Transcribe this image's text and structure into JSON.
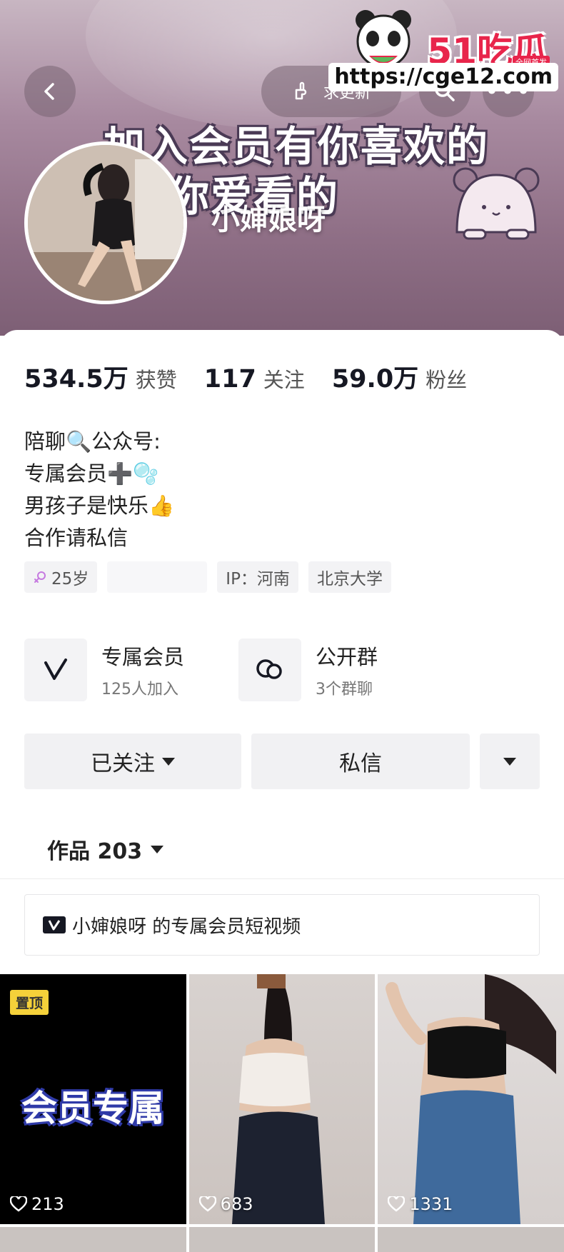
{
  "header": {
    "update_label": "求更新",
    "overlay_text_line1": "加入会员有你喜欢的",
    "overlay_text_line2": "有你爱看的",
    "nickname": "小婶娘呀"
  },
  "watermark": {
    "logo": "51吃瓜",
    "badge": "全网首发",
    "url": "https://cge12.com"
  },
  "stats": [
    {
      "num": "534.5万",
      "label": "获赞"
    },
    {
      "num": "117",
      "label": "关注"
    },
    {
      "num": "59.0万",
      "label": "粉丝"
    }
  ],
  "bio": [
    "陪聊🔍公众号:",
    "专属会员➕🫧",
    "男孩子是快乐👍",
    "合作请私信"
  ],
  "tags": {
    "age": "25岁",
    "ip": "IP：河南",
    "school": "北京大学"
  },
  "features": [
    {
      "title": "专属会员",
      "subtitle": "125人加入"
    },
    {
      "title": "公开群",
      "subtitle": "3个群聊"
    }
  ],
  "actions": {
    "follow_label": "已关注",
    "message_label": "私信"
  },
  "works_tab": {
    "label": "作品 203"
  },
  "member_bar": {
    "text": "小婶娘呀 的专属会员短视频"
  },
  "videos": [
    {
      "pin": "置顶",
      "title": "会员专属",
      "likes": "213"
    },
    {
      "likes": "683"
    },
    {
      "likes": "1331"
    }
  ]
}
